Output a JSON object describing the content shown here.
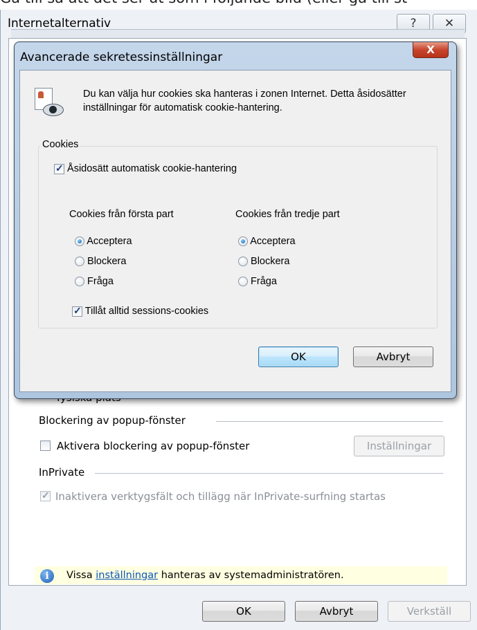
{
  "background_text": "Gå till så att det ser ut som i följande bild (eller gå till st",
  "outer_dialog": {
    "title": "Internetalternativ",
    "help_glyph": "?",
    "close_glyph": "✕",
    "partial_label": "fysiska plats",
    "popup_section": "Blockering av popup-fönster",
    "popup_checkbox": "Aktivera blockering av popup-fönster",
    "popup_settings_button": "Inställningar",
    "inprivate_section": "InPrivate",
    "inprivate_checkbox": "Inaktivera verktygsfält och tillägg när InPrivate-surfning startas",
    "info": {
      "prefix": "Vissa ",
      "link": "inställningar",
      "suffix": " hanteras av systemadministratören."
    },
    "buttons": {
      "ok": "OK",
      "cancel": "Avbryt",
      "apply": "Verkställ"
    }
  },
  "inner_dialog": {
    "title": "Avancerade sekretessinställningar",
    "close_glyph": "X",
    "description": "Du kan välja hur cookies ska hanteras i zonen Internet. Detta åsidosätter inställningar för automatisk cookie-hantering.",
    "group_label": "Cookies",
    "override_checkbox": "Åsidosätt automatisk cookie-hantering",
    "first_party": {
      "heading": "Cookies från första part",
      "options": [
        "Acceptera",
        "Blockera",
        "Fråga"
      ],
      "selected": "Acceptera"
    },
    "third_party": {
      "heading": "Cookies från tredje part",
      "options": [
        "Acceptera",
        "Blockera",
        "Fråga"
      ],
      "selected": "Acceptera"
    },
    "session_checkbox": "Tillåt alltid sessions-cookies",
    "buttons": {
      "ok": "OK",
      "cancel": "Avbryt"
    }
  }
}
